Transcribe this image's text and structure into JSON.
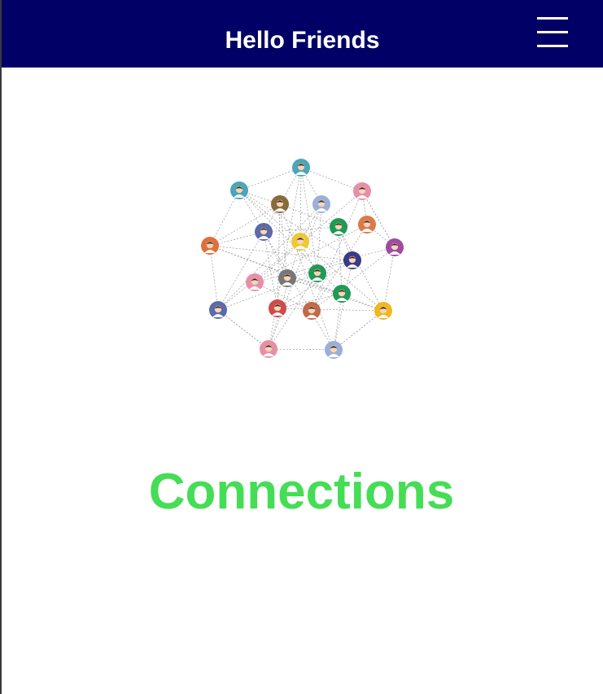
{
  "header": {
    "title": "Hello Friends",
    "menu_icon": "hamburger-menu-icon",
    "background": "#000066"
  },
  "main": {
    "illustration_icon": "people-network-illustration",
    "heading": "Connections",
    "heading_color": "#44dd55"
  }
}
